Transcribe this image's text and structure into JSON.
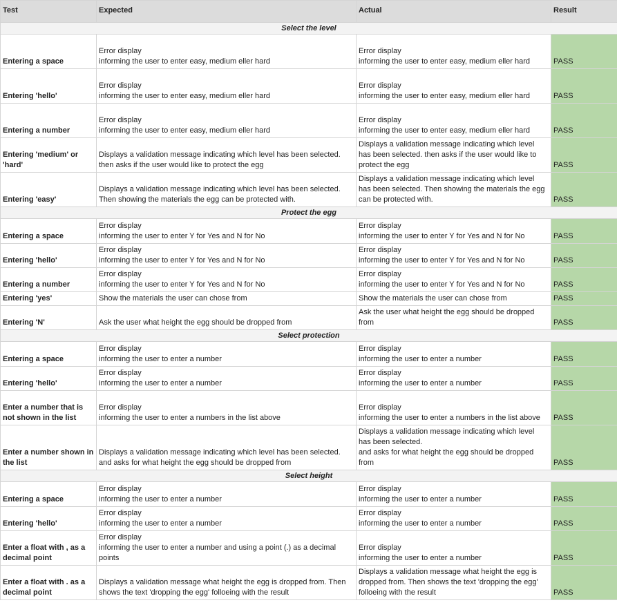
{
  "headers": {
    "test": "Test",
    "expected": "Expected",
    "actual": "Actual",
    "result": "Result"
  },
  "colors": {
    "header_bg": "#dcdcdc",
    "section_bg": "#f3f3f3",
    "pass_bg": "#b6d7a8"
  },
  "sections": [
    {
      "title": "Select the level",
      "rows": [
        {
          "test": "Entering  a space",
          "expected": "Error display\ninforming the user to enter easy, medium eller hard",
          "actual": "Error display\ninforming the user to enter easy, medium eller hard",
          "result": "PASS"
        },
        {
          "test": "Entering 'hello'",
          "expected": "Error display\ninforming the user to enter easy, medium eller hard",
          "actual": "Error display\ninforming the user to enter easy, medium eller hard",
          "result": "PASS"
        },
        {
          "test": "Entering a number",
          "expected": "Error display\ninforming the user to enter easy, medium eller hard",
          "actual": "Error display\ninforming the user to enter easy, medium eller hard",
          "result": "PASS"
        },
        {
          "test": "Entering 'medium' or 'hard'",
          "expected": "Displays a validation message indicating which level has been selected. then asks if the user would like to protect the egg",
          "actual": "Displays a validation message indicating which level has been selected. then asks if the user would like to protect the egg",
          "result": "PASS"
        },
        {
          "test": "Entering 'easy'",
          "expected": "Displays a validation message indicating which level has been selected. Then showing the materials the egg can be protected with.",
          "actual": "Displays a validation message indicating which level has been selected. Then showing the materials the egg can be protected with.",
          "result": "PASS"
        }
      ]
    },
    {
      "title": "Protect the egg",
      "rows": [
        {
          "test": "Entering  a space",
          "expected": "Error display\ninforming the user to enter Y for Yes and N for No",
          "actual": "Error display\ninforming the user to enter Y for Yes and N for No",
          "result": "PASS"
        },
        {
          "test": "Entering 'hello'",
          "expected": "Error display\ninforming the user to enter Y for Yes and N for No",
          "actual": "Error display\ninforming the user to enter Y for Yes and N for No",
          "result": "PASS"
        },
        {
          "test": "Entering a number",
          "expected": "Error display\ninforming the user to enter Y for Yes and N for No",
          "actual": "Error display\ninforming the user to enter Y for Yes and N for No",
          "result": "PASS"
        },
        {
          "test": "Entering 'yes'",
          "expected": "Show the materials the user can chose from",
          "actual": "Show the materials the user can chose from",
          "result": "PASS"
        },
        {
          "test": "Entering 'N'",
          "expected": "Ask the user what height the egg should be dropped from",
          "actual": "Ask the user what height the egg should be dropped from",
          "result": "PASS"
        }
      ]
    },
    {
      "title": "Select protection",
      "rows": [
        {
          "test": "Entering  a space",
          "expected": "Error display\ninforming the user to enter a number",
          "actual": "Error display\ninforming the user to enter a number",
          "result": "PASS"
        },
        {
          "test": "Entering 'hello'",
          "expected": "Error display\ninforming the user to enter a number",
          "actual": "Error display\ninforming the user to enter a number",
          "result": "PASS"
        },
        {
          "test": "Enter a number that is not shown in the list",
          "expected": "Error display\ninforming the user to enter a numbers in the list above",
          "actual": "Error display\ninforming the user to enter a numbers in the list above",
          "result": "PASS"
        },
        {
          "test": "Enter a number shown in the list",
          "expected": "Displays a validation message indicating which level has been selected.\nand asks for what height the egg should be dropped from",
          "actual": "Displays a validation message indicating which level has been selected.\nand asks for what height the egg should be dropped from",
          "result": "PASS"
        }
      ]
    },
    {
      "title": "Select height",
      "rows": [
        {
          "test": "Entering  a space",
          "expected": "Error display\ninforming the user to enter a number",
          "actual": "Error display\ninforming the user to enter a number",
          "result": "PASS"
        },
        {
          "test": "Entering 'hello'",
          "expected": "Error display\ninforming the user to enter a number",
          "actual": "Error display\ninforming the user to enter a number",
          "result": "PASS"
        },
        {
          "test": "Enter a float with , as a decimal point",
          "expected": "Error display\ninforming the user to enter a number and using a point (.) as a decimal points",
          "actual": "Error display\ninforming the user to enter a number",
          "result": "PASS"
        },
        {
          "test": "Enter a float with . as a decimal point",
          "expected": "Displays a validation message what height the egg is dropped from. Then shows the text 'dropping the egg' folloeing with the result",
          "actual": "Displays a validation message what height the egg is dropped from. Then shows the text 'dropping the egg' folloeing with the result",
          "result": "PASS"
        }
      ]
    }
  ]
}
